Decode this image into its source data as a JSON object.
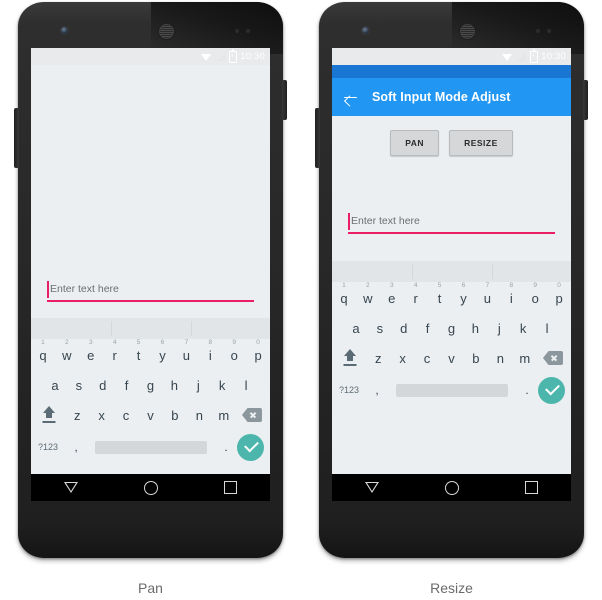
{
  "figure": {
    "panels": [
      {
        "caption": "Pan",
        "mode": "pan",
        "has_appbar": false,
        "status": {
          "time": "10:30"
        },
        "edit_text": {
          "hint": "Enter text here",
          "value": ""
        }
      },
      {
        "caption": "Resize",
        "mode": "resize",
        "has_appbar": true,
        "status": {
          "time": "10:30"
        },
        "appbar": {
          "title": "Soft Input Mode Adjust",
          "back_icon": "back-arrow-icon"
        },
        "buttons": [
          {
            "label": "PAN"
          },
          {
            "label": "RESIZE"
          }
        ],
        "edit_text": {
          "hint": "Enter text here",
          "value": ""
        }
      }
    ]
  },
  "keyboard": {
    "suggestions": [
      "",
      "",
      ""
    ],
    "row1": [
      {
        "letter": "q",
        "number": "1"
      },
      {
        "letter": "w",
        "number": "2"
      },
      {
        "letter": "e",
        "number": "3"
      },
      {
        "letter": "r",
        "number": "4"
      },
      {
        "letter": "t",
        "number": "5"
      },
      {
        "letter": "y",
        "number": "6"
      },
      {
        "letter": "u",
        "number": "7"
      },
      {
        "letter": "i",
        "number": "8"
      },
      {
        "letter": "o",
        "number": "9"
      },
      {
        "letter": "p",
        "number": "0"
      }
    ],
    "row2": [
      "a",
      "s",
      "d",
      "f",
      "g",
      "h",
      "j",
      "k",
      "l"
    ],
    "row3": [
      "z",
      "x",
      "c",
      "v",
      "b",
      "n",
      "m"
    ],
    "row4": {
      "symbols": "?123",
      "comma": ",",
      "period": ".",
      "space": ""
    },
    "shift_icon": "shift-icon",
    "backspace_icon": "backspace-icon",
    "enter_icon": "check-icon"
  },
  "navbar": {
    "back": "back-triangle-icon",
    "home": "home-circle-icon",
    "recents": "recents-square-icon"
  },
  "colors": {
    "appbar": "#2196f3",
    "statusbar_blue": "#1976d2",
    "accent_pink": "#e91e63",
    "enter_teal": "#4db6ac",
    "screen_bg": "#eceff1"
  }
}
